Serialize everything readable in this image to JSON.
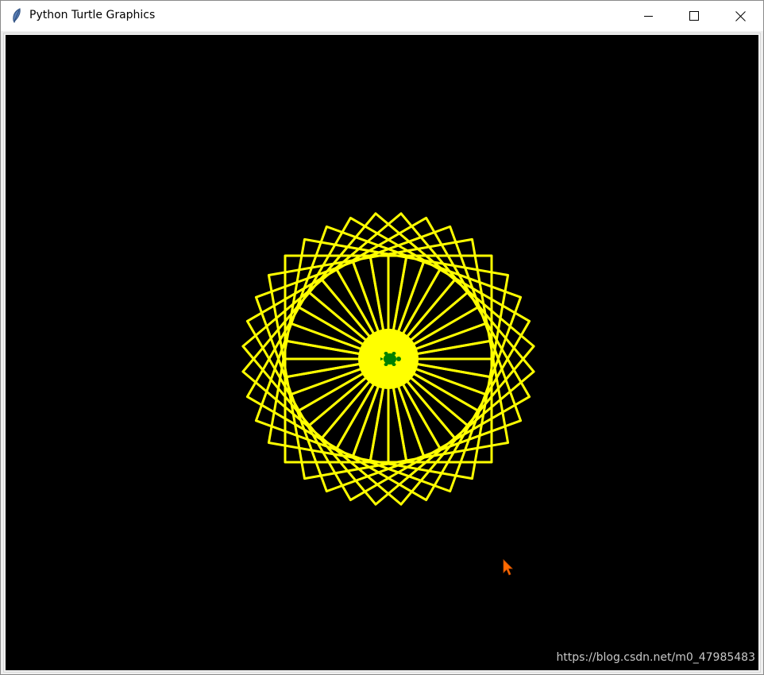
{
  "window": {
    "title": "Python Turtle Graphics",
    "icon": "feather-icon"
  },
  "controls": {
    "minimize": "minimize-icon",
    "maximize": "maximize-icon",
    "close": "close-icon"
  },
  "canvas": {
    "background": "#000000",
    "pen_color": "#ffff00",
    "turtle_color": "#008000",
    "cursor_color": "#ff6a00",
    "square_count": 36,
    "rotation_step_degrees": 10
  },
  "watermark": "https://blog.csdn.net/m0_47985483"
}
